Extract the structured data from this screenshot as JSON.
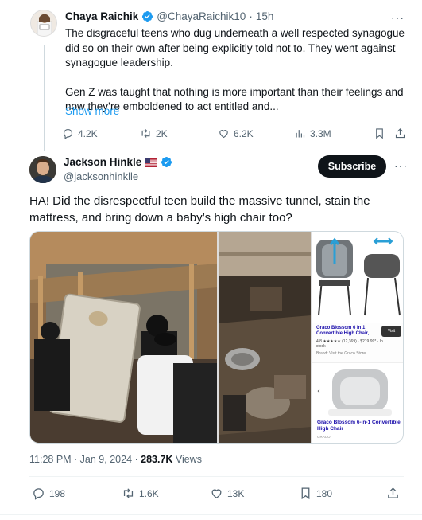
{
  "quoted_tweet": {
    "name": "Chaya Raichik",
    "handle": "@ChayaRaichik10",
    "time": "15h",
    "paragraph1": "The disgraceful teens who dug underneath a well respected synagogue did so on their own after being explicitly told not to. They went against synagogue leadership.",
    "paragraph2": "Gen Z was taught that nothing is more important than their feelings and now they’re emboldened to act entitled and...",
    "show_more": "Show more",
    "replies": "4.2K",
    "retweets": "2K",
    "likes": "6.2K",
    "views": "3.3M"
  },
  "main_tweet": {
    "name": "Jackson Hinkle",
    "handle": "@jacksonhinklle",
    "subscribe_label": "Subscribe",
    "text": "HA! Did the disrespectful teen build the massive tunnel, stain the mattress, and bring down a baby’s high chair too?",
    "media_product": {
      "title": "Graco Blossom 6 in 1 Convertible High Chair,...",
      "rating": "4.8 ★★★★★ (12,369) · $219.99* · In stock",
      "brand": "Brand: Visit the Graco Store",
      "visit": "Visit",
      "caption": "Graco Blossom 6-in-1 Convertible High Chair",
      "caption_brand": "GRACO"
    },
    "timestamp": "11:28 PM · Jan 9, 2024 · ",
    "views_count": "283.7K",
    "views_label": " Views",
    "replies": "198",
    "retweets": "1.6K",
    "likes": "13K",
    "bookmarks": "180"
  },
  "colors": {
    "accent": "#1d9bf0",
    "text": "#0f1419",
    "muted": "#536471"
  },
  "icons": [
    "verified-badge-icon",
    "more-icon",
    "reply-icon",
    "retweet-icon",
    "like-icon",
    "views-icon",
    "bookmark-icon",
    "share-icon",
    "us-flag-icon"
  ]
}
